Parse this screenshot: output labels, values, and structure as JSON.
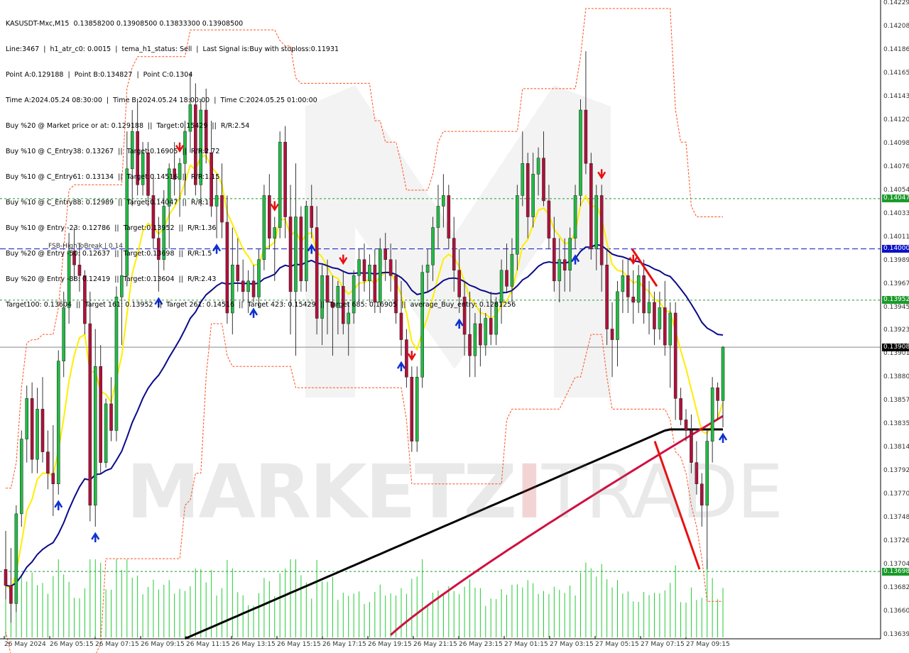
{
  "symbol_header": "KASUSDT-Mxc,M15  0.13858200 0.13908500 0.13833300 0.13908500",
  "info_lines": [
    "Line:3467  |  h1_atr_c0: 0.0015  |  tema_h1_status: Sell  |  Last Signal is:Buy with stoploss:0.11931",
    "Point A:0.129188  |  Point B:0.134827  |  Point C:0.1304",
    "Time A:2024.05.24 08:30:00  |  Time B:2024.05.24 18:00:00  |  Time C:2024.05.25 01:00:00",
    "Buy %20 @ Market price or at: 0.129188  ||  Target:0.15429  ||  R/R:2.54",
    "Buy %10 @ C_Entry38: 0.13267  ||  Target:0.16905  ||  R/R:2.72",
    "Buy %10 @ C_Entry61: 0.13134  ||  Target:0.14516  ||  R/R:1.15",
    "Buy %10 @ C_Entry88: 0.12989  ||  Target:0.14047  ||  R/R:1",
    "Buy %10 @ Entry -23: 0.12786  ||  Target:0.13952  ||  R/R:1.36",
    "Buy %20 @ Entry -50: 0.12637  ||  Target:0.13698  ||  R/R:1.5",
    "Buy %20 @ Entry -88: 0.12419  ||  Target:0.13604  ||  R/R:2.43",
    "Target100: 0.13604  ||  Target 161: 0.13952  ||  Target 261: 0.14516  ||  Target 423: 0.15429  ||  Target 685: 0.16905  ||  average_Buy_entry: 0.1281256"
  ],
  "fsb_label": "FSB-HighToBreak | 0.14",
  "watermark": {
    "main": "MARKETZ",
    "bar": "I",
    "trade": "TRADE"
  },
  "price_axis": [
    "0.14229",
    "0.14208",
    "0.14186",
    "0.14165",
    "0.14143",
    "0.14120",
    "0.14098",
    "0.14076",
    "0.14054",
    "0.14033",
    "0.14011",
    "0.13989",
    "0.13967",
    "0.13945",
    "0.13923",
    "0.13901",
    "0.13880",
    "0.13857",
    "0.13835",
    "0.13814",
    "0.13792",
    "0.13770",
    "0.13748",
    "0.13726",
    "0.13704",
    "0.13682",
    "0.13660",
    "0.13639"
  ],
  "price_tags": [
    {
      "value": "0.14047",
      "color": "#1a9a2a"
    },
    {
      "value": "0.14000",
      "color": "#0a12c8"
    },
    {
      "value": "0.13952",
      "color": "#1a9a2a"
    },
    {
      "value": "0.13908",
      "color": "#000000"
    },
    {
      "value": "0.13698",
      "color": "#1a9a2a"
    }
  ],
  "time_axis": [
    "26 May 2024",
    "26 May 05:15",
    "26 May 07:15",
    "26 May 09:15",
    "26 May 11:15",
    "26 May 13:15",
    "26 May 15:15",
    "26 May 17:15",
    "26 May 19:15",
    "26 May 21:15",
    "26 May 23:15",
    "27 May 01:15",
    "27 May 03:15",
    "27 May 05:15",
    "27 May 07:15",
    "27 May 09:15"
  ],
  "colors": {
    "bull": "#22bb44",
    "bear": "#b0103a",
    "ma_blue": "#0a0a8a",
    "ma_black": "#000000",
    "ma_red": "#d01040",
    "yellow": "#ffee00",
    "channel": "#ff5020",
    "level_green": "#1a9a2a",
    "level_blue": "#0a12c8",
    "volume": "#22cc33",
    "arrow_up": "#1030d0",
    "arrow_down": "#e81010"
  },
  "chart_data": {
    "type": "candlestick",
    "symbol": "KASUSDT-Mxc",
    "timeframe": "M15",
    "ylim": [
      0.13635,
      0.14233
    ],
    "levels": {
      "target_14047": 0.14047,
      "fsb_high_to_break": 0.14,
      "target_13952": 0.13952,
      "last_price": 0.13908,
      "target_13698": 0.13698
    },
    "candles_ohlc": [
      [
        0.137,
        0.13736,
        0.13672,
        0.13685
      ],
      [
        0.13685,
        0.1372,
        0.1365,
        0.13668
      ],
      [
        0.13668,
        0.1376,
        0.1366,
        0.13752
      ],
      [
        0.13752,
        0.1383,
        0.1374,
        0.13822
      ],
      [
        0.13822,
        0.13872,
        0.138,
        0.1386
      ],
      [
        0.1386,
        0.13875,
        0.1379,
        0.13803
      ],
      [
        0.13803,
        0.1387,
        0.1379,
        0.1385
      ],
      [
        0.1385,
        0.1388,
        0.138,
        0.1381
      ],
      [
        0.1381,
        0.1383,
        0.13775,
        0.1379
      ],
      [
        0.1379,
        0.13835,
        0.1375,
        0.1378
      ],
      [
        0.1378,
        0.13905,
        0.1377,
        0.13895
      ],
      [
        0.13895,
        0.1396,
        0.1388,
        0.13945
      ],
      [
        0.13945,
        0.14015,
        0.1393,
        0.13998
      ],
      [
        0.13998,
        0.1402,
        0.1397,
        0.13985
      ],
      [
        0.13985,
        0.14005,
        0.1396,
        0.13975
      ],
      [
        0.13975,
        0.1398,
        0.1392,
        0.1393
      ],
      [
        0.1393,
        0.1396,
        0.13745,
        0.1376
      ],
      [
        0.1376,
        0.13925,
        0.1374,
        0.1389
      ],
      [
        0.1389,
        0.1391,
        0.1379,
        0.138
      ],
      [
        0.138,
        0.1386,
        0.13795,
        0.13855
      ],
      [
        0.13855,
        0.1388,
        0.1382,
        0.1383
      ],
      [
        0.1383,
        0.13965,
        0.1382,
        0.13955
      ],
      [
        0.13955,
        0.14,
        0.1391,
        0.13975
      ],
      [
        0.13975,
        0.1411,
        0.13965,
        0.14075
      ],
      [
        0.14075,
        0.1413,
        0.1404,
        0.1411
      ],
      [
        0.1411,
        0.1414,
        0.1405,
        0.1406
      ],
      [
        0.1406,
        0.141,
        0.1405,
        0.1409
      ],
      [
        0.1409,
        0.141,
        0.1404,
        0.1405
      ],
      [
        0.1405,
        0.1407,
        0.14,
        0.1401
      ],
      [
        0.1401,
        0.1403,
        0.1396,
        0.1399
      ],
      [
        0.1399,
        0.14055,
        0.1398,
        0.1404
      ],
      [
        0.1404,
        0.1408,
        0.14,
        0.14075
      ],
      [
        0.14075,
        0.141,
        0.1405,
        0.14065
      ],
      [
        0.14065,
        0.14085,
        0.1403,
        0.1408
      ],
      [
        0.1408,
        0.1412,
        0.1405,
        0.1411
      ],
      [
        0.1411,
        0.14165,
        0.1409,
        0.14135
      ],
      [
        0.14135,
        0.14155,
        0.1405,
        0.1406
      ],
      [
        0.1406,
        0.1414,
        0.1404,
        0.1413
      ],
      [
        0.1413,
        0.1415,
        0.1408,
        0.1409
      ],
      [
        0.1409,
        0.1412,
        0.1403,
        0.1404
      ],
      [
        0.1404,
        0.1407,
        0.1401,
        0.1405
      ],
      [
        0.1405,
        0.1408,
        0.1401,
        0.14025
      ],
      [
        0.14025,
        0.1405,
        0.1393,
        0.1394
      ],
      [
        0.1394,
        0.1402,
        0.1392,
        0.13985
      ],
      [
        0.13985,
        0.1401,
        0.1396,
        0.1397
      ],
      [
        0.1397,
        0.1399,
        0.1395,
        0.1396
      ],
      [
        0.1396,
        0.1398,
        0.1394,
        0.1397
      ],
      [
        0.1397,
        0.13985,
        0.1395,
        0.13955
      ],
      [
        0.13955,
        0.14,
        0.13945,
        0.1399
      ],
      [
        0.1399,
        0.1406,
        0.1398,
        0.1405
      ],
      [
        0.1405,
        0.1407,
        0.14,
        0.1401
      ],
      [
        0.1401,
        0.1403,
        0.1397,
        0.1402
      ],
      [
        0.1402,
        0.1411,
        0.1401,
        0.141
      ],
      [
        0.141,
        0.14115,
        0.1401,
        0.1403
      ],
      [
        0.1403,
        0.1406,
        0.1392,
        0.1396
      ],
      [
        0.1396,
        0.1408,
        0.139,
        0.1403
      ],
      [
        0.1403,
        0.1404,
        0.1396,
        0.1397
      ],
      [
        0.1397,
        0.14045,
        0.1396,
        0.1404
      ],
      [
        0.1404,
        0.1406,
        0.1401,
        0.1402
      ],
      [
        0.1402,
        0.1404,
        0.1392,
        0.13935
      ],
      [
        0.13935,
        0.13985,
        0.1391,
        0.13975
      ],
      [
        0.13975,
        0.1399,
        0.1392,
        0.1395
      ],
      [
        0.1395,
        0.13975,
        0.139,
        0.13945
      ],
      [
        0.13945,
        0.1397,
        0.1392,
        0.13965
      ],
      [
        0.13965,
        0.1398,
        0.1392,
        0.1393
      ],
      [
        0.1393,
        0.1395,
        0.139,
        0.1394
      ],
      [
        0.1394,
        0.1398,
        0.1393,
        0.13975
      ],
      [
        0.13975,
        0.14,
        0.1395,
        0.1399
      ],
      [
        0.1399,
        0.14005,
        0.1396,
        0.1397
      ],
      [
        0.1397,
        0.13995,
        0.1395,
        0.13985
      ],
      [
        0.13985,
        0.14,
        0.1394,
        0.1395
      ],
      [
        0.1395,
        0.1401,
        0.1394,
        0.14
      ],
      [
        0.14,
        0.14015,
        0.1397,
        0.1399
      ],
      [
        0.1399,
        0.14005,
        0.1396,
        0.13975
      ],
      [
        0.13975,
        0.1399,
        0.1393,
        0.1394
      ],
      [
        0.1394,
        0.1397,
        0.139,
        0.13915
      ],
      [
        0.13915,
        0.13925,
        0.1387,
        0.1388
      ],
      [
        0.1388,
        0.1389,
        0.1381,
        0.1382
      ],
      [
        0.1382,
        0.1389,
        0.1381,
        0.1388
      ],
      [
        0.1388,
        0.13985,
        0.1387,
        0.13978
      ],
      [
        0.13978,
        0.14,
        0.1396,
        0.13985
      ],
      [
        0.13985,
        0.1403,
        0.1397,
        0.1402
      ],
      [
        0.1402,
        0.1406,
        0.14,
        0.1404
      ],
      [
        0.1404,
        0.1407,
        0.1402,
        0.1405
      ],
      [
        0.1405,
        0.1406,
        0.14,
        0.1401
      ],
      [
        0.1401,
        0.1403,
        0.1396,
        0.1398
      ],
      [
        0.1398,
        0.14,
        0.1394,
        0.13955
      ],
      [
        0.13955,
        0.1397,
        0.139,
        0.1392
      ],
      [
        0.1392,
        0.1396,
        0.1388,
        0.139
      ],
      [
        0.139,
        0.1394,
        0.1388,
        0.1393
      ],
      [
        0.1393,
        0.13945,
        0.1389,
        0.1391
      ],
      [
        0.1391,
        0.1394,
        0.139,
        0.13935
      ],
      [
        0.13935,
        0.1396,
        0.1391,
        0.1392
      ],
      [
        0.1392,
        0.13955,
        0.1391,
        0.1395
      ],
      [
        0.1395,
        0.1399,
        0.1393,
        0.1398
      ],
      [
        0.1398,
        0.14005,
        0.1396,
        0.13965
      ],
      [
        0.13965,
        0.1401,
        0.1395,
        0.13995
      ],
      [
        0.13995,
        0.1406,
        0.1398,
        0.1405
      ],
      [
        0.1405,
        0.1411,
        0.1404,
        0.1408
      ],
      [
        0.1408,
        0.1409,
        0.1401,
        0.1403
      ],
      [
        0.1403,
        0.1409,
        0.1402,
        0.1407
      ],
      [
        0.1407,
        0.14095,
        0.1405,
        0.14085
      ],
      [
        0.14085,
        0.1411,
        0.1404,
        0.14045
      ],
      [
        0.14045,
        0.1406,
        0.14,
        0.1401
      ],
      [
        0.1401,
        0.1403,
        0.1396,
        0.1397
      ],
      [
        0.1397,
        0.1401,
        0.1395,
        0.1399
      ],
      [
        0.1399,
        0.1401,
        0.1396,
        0.1398
      ],
      [
        0.1398,
        0.1402,
        0.1396,
        0.1401
      ],
      [
        0.1401,
        0.1406,
        0.14,
        0.1405
      ],
      [
        0.1405,
        0.1414,
        0.1404,
        0.1413
      ],
      [
        0.1413,
        0.14185,
        0.1407,
        0.1408
      ],
      [
        0.1408,
        0.1409,
        0.1399,
        0.14
      ],
      [
        0.14,
        0.1406,
        0.1398,
        0.1405
      ],
      [
        0.1405,
        0.1406,
        0.1396,
        0.13985
      ],
      [
        0.13985,
        0.14,
        0.1391,
        0.13925
      ],
      [
        0.13925,
        0.1395,
        0.1388,
        0.13915
      ],
      [
        0.13915,
        0.1397,
        0.1389,
        0.1396
      ],
      [
        0.1396,
        0.1399,
        0.1394,
        0.13975
      ],
      [
        0.13975,
        0.1399,
        0.1394,
        0.13955
      ],
      [
        0.13955,
        0.1398,
        0.1393,
        0.1395
      ],
      [
        0.1395,
        0.13985,
        0.1394,
        0.13975
      ],
      [
        0.13975,
        0.1399,
        0.1393,
        0.1394
      ],
      [
        0.1394,
        0.1397,
        0.1392,
        0.1395
      ],
      [
        0.1395,
        0.1396,
        0.1391,
        0.13925
      ],
      [
        0.13925,
        0.1396,
        0.13915,
        0.13945
      ],
      [
        0.13945,
        0.1397,
        0.139,
        0.1391
      ],
      [
        0.1391,
        0.1395,
        0.1387,
        0.1394
      ],
      [
        0.1394,
        0.1395,
        0.1384,
        0.1386
      ],
      [
        0.1386,
        0.1387,
        0.13835,
        0.1384
      ],
      [
        0.1384,
        0.1385,
        0.1382,
        0.1383
      ],
      [
        0.1383,
        0.13845,
        0.1379,
        0.138
      ],
      [
        0.138,
        0.1382,
        0.1377,
        0.1378
      ],
      [
        0.1378,
        0.1379,
        0.1374,
        0.1376
      ],
      [
        0.1376,
        0.1383,
        0.137,
        0.1382
      ],
      [
        0.1382,
        0.1388,
        0.138,
        0.1387
      ],
      [
        0.1387,
        0.13875,
        0.1384,
        0.13858
      ],
      [
        0.13858,
        0.13909,
        0.13833,
        0.13908
      ]
    ],
    "volume_note": "green volume histogram at the bottom of the pane"
  }
}
